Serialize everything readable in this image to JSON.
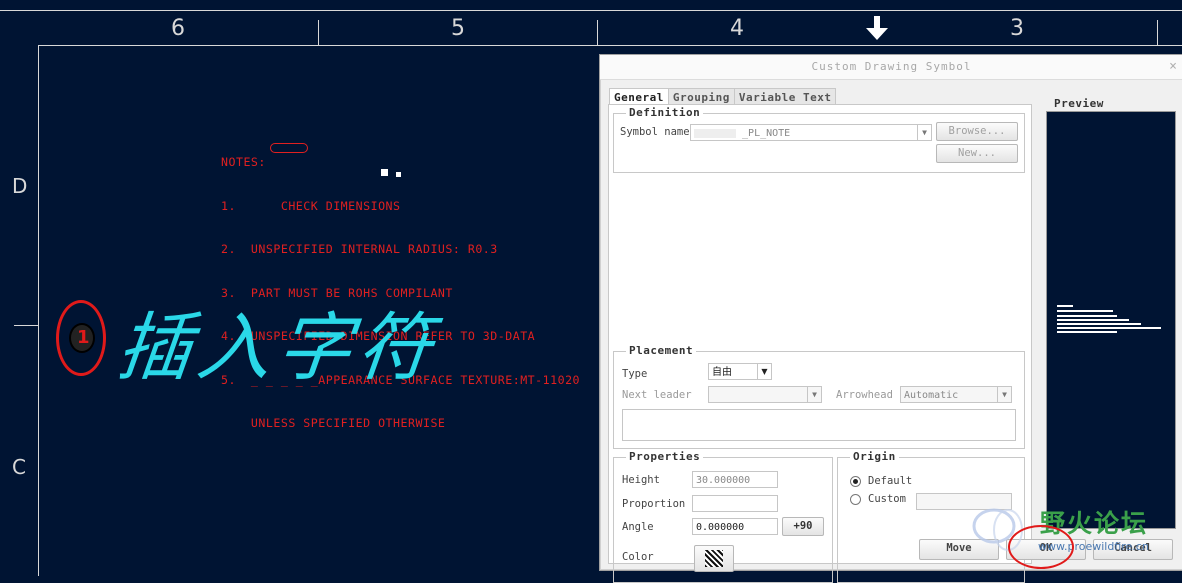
{
  "sheet": {
    "zone_numbers": [
      "6",
      "5",
      "4",
      "3"
    ],
    "row_letters": [
      "D",
      "C"
    ],
    "notes": [
      "NOTES:",
      "1.      CHECK DIMENSIONS",
      "2.  UNSPECIFIED INTERNAL RADIUS: R0.3",
      "3.  PART MUST BE ROHS COMPILANT",
      "4.  UNSPECIFIED DIMENSION REFER TO 3D-DATA",
      "5.  _ _ _ _ _APPEARANCE SURFACE TEXTURE:MT-11020",
      "    UNLESS SPECIFIED OTHERWISE"
    ],
    "annotation_text": "插入字符",
    "annotation_circle_label": "1"
  },
  "dialog": {
    "title": "Custom Drawing Symbol",
    "close_glyph": "×",
    "tabs": [
      "General",
      "Grouping",
      "Variable Text"
    ],
    "definition": {
      "label": "Definition",
      "symbol_name_label": "Symbol name",
      "symbol_name_value": "_PL_NOTE",
      "browse_label": "Browse...",
      "new_label": "New..."
    },
    "placement": {
      "label": "Placement",
      "type_label": "Type",
      "type_value": "自由",
      "next_leader_label": "Next leader",
      "next_leader_value": "",
      "arrowhead_label": "Arrowhead",
      "arrowhead_value": "Automatic"
    },
    "properties": {
      "label": "Properties",
      "height_label": "Height",
      "height_value": "30.000000",
      "proportion_label": "Proportion",
      "proportion_value": "",
      "angle_label": "Angle",
      "angle_value": "0.000000",
      "plus90_label": "+90",
      "color_label": "Color"
    },
    "origin": {
      "label": "Origin",
      "default_label": "Default",
      "custom_label": "Custom",
      "selected": "Default"
    },
    "preview": {
      "label": "Preview"
    },
    "buttons": {
      "move": "Move",
      "ok": "OK",
      "cancel": "Cancel"
    }
  },
  "watermark": {
    "text": "野火论坛",
    "url": "www.proewildfire.cn"
  }
}
